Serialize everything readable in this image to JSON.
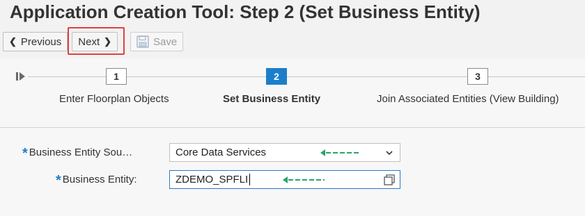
{
  "title": "Application Creation Tool: Step 2  (Set Business Entity)",
  "toolbar": {
    "previous_label": "Previous",
    "next_label": "Next",
    "save_label": "Save"
  },
  "roadmap": {
    "steps": [
      {
        "number": "1",
        "label": "Enter Floorplan Objects",
        "active": false
      },
      {
        "number": "2",
        "label": "Set Business Entity",
        "active": true
      },
      {
        "number": "3",
        "label": "Join Associated Entities (View Building)",
        "active": false
      }
    ]
  },
  "form": {
    "source_label": "Business Entity Sou…",
    "source_value": "Core Data Services",
    "entity_label": "Business Entity:",
    "entity_value": "ZDEMO_SPFLI"
  },
  "colors": {
    "accent": "#1c7ecb",
    "required_star": "#1f7fc8",
    "highlight": "#e04040",
    "annotation_arrow": "#2aa36b"
  }
}
